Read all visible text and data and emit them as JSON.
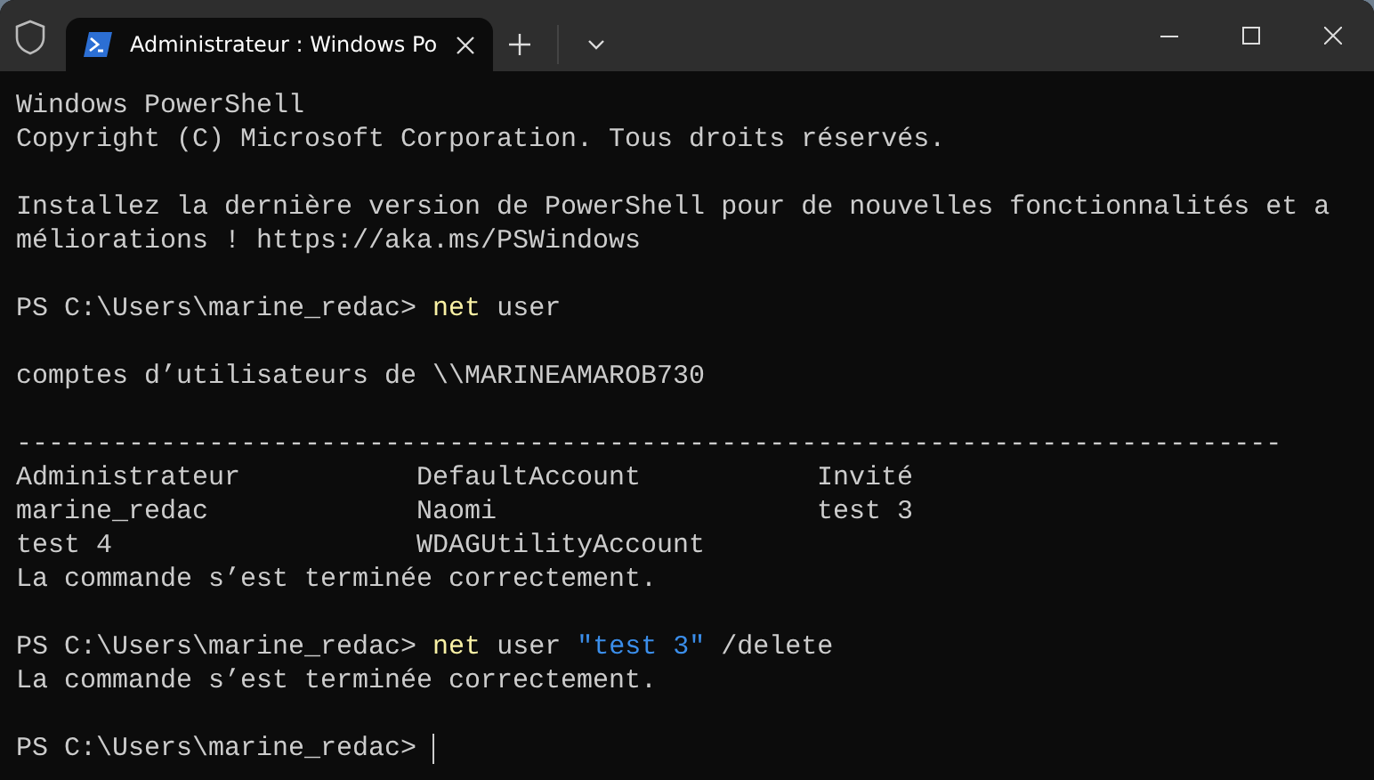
{
  "tab": {
    "title": "Administrateur : Windows Po",
    "selected": true
  },
  "lines": [
    {
      "kind": "text",
      "text": "Windows PowerShell"
    },
    {
      "kind": "text",
      "text": "Copyright (C) Microsoft Corporation. Tous droits réservés."
    },
    {
      "kind": "blank"
    },
    {
      "kind": "text",
      "text": "Installez la dernière version de PowerShell pour de nouvelles fonctionnalités et a"
    },
    {
      "kind": "text",
      "text": "méliorations ! https://aka.ms/PSWindows"
    },
    {
      "kind": "blank"
    },
    {
      "kind": "prompt",
      "prompt": "PS C:\\Users\\marine_redac>",
      "segments": [
        {
          "kind": "command",
          "text": "net"
        },
        {
          "kind": "argument",
          "text": "user"
        }
      ]
    },
    {
      "kind": "blank"
    },
    {
      "kind": "text",
      "text": "comptes d’utilisateurs de \\\\MARINEAMAROB730"
    },
    {
      "kind": "blank"
    },
    {
      "kind": "text",
      "text": "-------------------------------------------------------------------------------"
    },
    {
      "kind": "columns",
      "cells": [
        "Administrateur",
        "DefaultAccount",
        "Invité"
      ]
    },
    {
      "kind": "columns",
      "cells": [
        "marine_redac",
        "Naomi",
        "test 3"
      ]
    },
    {
      "kind": "columns",
      "cells": [
        "test 4",
        "WDAGUtilityAccount"
      ]
    },
    {
      "kind": "text",
      "text": "La commande s’est terminée correctement."
    },
    {
      "kind": "blank"
    },
    {
      "kind": "prompt",
      "prompt": "PS C:\\Users\\marine_redac>",
      "segments": [
        {
          "kind": "command",
          "text": "net"
        },
        {
          "kind": "argument",
          "text": "user"
        },
        {
          "kind": "string",
          "text": "\"test 3\""
        },
        {
          "kind": "argument",
          "text": "/delete"
        }
      ]
    },
    {
      "kind": "text",
      "text": "La commande s’est terminée correctement."
    },
    {
      "kind": "blank"
    },
    {
      "kind": "prompt",
      "prompt": "PS C:\\Users\\marine_redac>",
      "cursor": true
    }
  ]
}
